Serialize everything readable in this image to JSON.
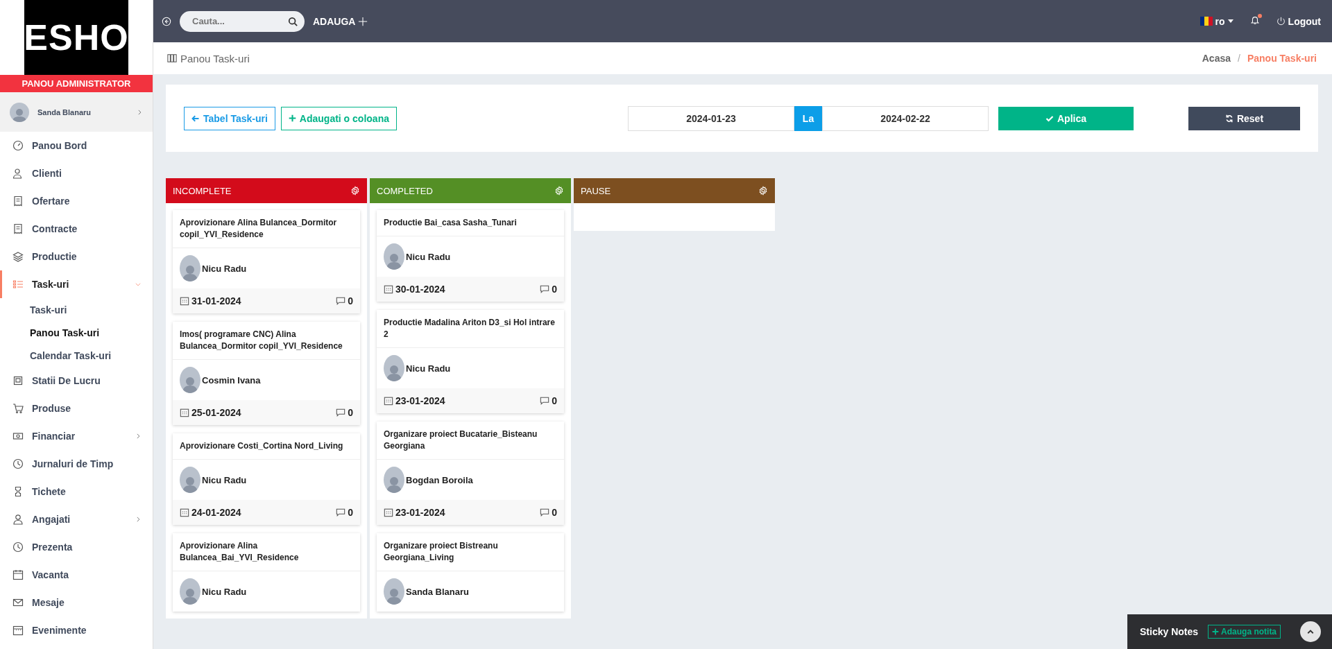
{
  "sidebar": {
    "logo": "ESHO",
    "role_banner": "PANOU ADMINISTRATOR",
    "user": {
      "name": "Sanda Blanaru"
    },
    "items": [
      {
        "label": "Panou Bord",
        "selected": false
      },
      {
        "label": "Clienti",
        "selected": false
      },
      {
        "label": "Ofertare",
        "selected": false
      },
      {
        "label": "Contracte",
        "selected": false
      },
      {
        "label": "Productie",
        "selected": false
      },
      {
        "label": "Task-uri",
        "selected": true,
        "expanded": true,
        "children": [
          {
            "label": "Task-uri",
            "selected": false
          },
          {
            "label": "Panou Task-uri",
            "selected": true
          },
          {
            "label": "Calendar Task-uri",
            "selected": false
          }
        ]
      },
      {
        "label": "Statii De Lucru",
        "selected": false
      },
      {
        "label": "Produse",
        "selected": false
      },
      {
        "label": "Financiar",
        "selected": false,
        "expanded": false
      },
      {
        "label": "Jurnaluri de Timp",
        "selected": false
      },
      {
        "label": "Tichete",
        "selected": false
      },
      {
        "label": "Angajati",
        "selected": false,
        "expanded": false
      },
      {
        "label": "Prezenta",
        "selected": false
      },
      {
        "label": "Vacanta",
        "selected": false
      },
      {
        "label": "Mesaje",
        "selected": false
      },
      {
        "label": "Evenimente",
        "selected": false
      }
    ]
  },
  "topbar": {
    "search": {
      "placeholder": "Cauta..."
    },
    "add_label": "ADAUGA",
    "language": "ro",
    "notification_dot": true,
    "logout": "Logout"
  },
  "page_header": {
    "title": "Panou Task-uri",
    "separator": "/",
    "breadcrumb": [
      {
        "label": "Acasa",
        "selected": false
      },
      {
        "label": "Panou Task-uri",
        "selected": true
      }
    ]
  },
  "filters": {
    "table_button": "Tabel Task-uri",
    "add_column_button": "Adaugati o coloana",
    "date_from": "2024-01-23",
    "separator": "La",
    "date_to": "2024-02-22",
    "apply": "Aplica",
    "reset": "Reset"
  },
  "columns": [
    {
      "title": "INCOMPLETE",
      "color": "#d30b1b",
      "cards": [
        {
          "title": "Aprovizionare Alina Bulancea_Dormitor copil_YVI_Residence",
          "assignee": "Nicu Radu",
          "date": "31-01-2024",
          "comments": "0"
        },
        {
          "title": "Imos( programare CNC) Alina Bulancea_Dormitor copil_YVI_Residence",
          "assignee": "Cosmin Ivana",
          "date": "25-01-2024",
          "comments": "0"
        },
        {
          "title": "Aprovizionare Costi_Cortina Nord_Living",
          "assignee": "Nicu Radu",
          "date": "24-01-2024",
          "comments": "0"
        },
        {
          "title": "Aprovizionare Alina Bulancea_Bai_YVI_Residence",
          "assignee": "Nicu Radu"
        }
      ]
    },
    {
      "title": "COMPLETED",
      "color": "#548f25",
      "cards": [
        {
          "title": "Productie Bai_casa Sasha_Tunari",
          "assignee": "Nicu Radu",
          "date": "30-01-2024",
          "comments": "0"
        },
        {
          "title": "Productie Madalina Ariton D3_si Hol intrare 2",
          "assignee": "Nicu Radu",
          "date": "23-01-2024",
          "comments": "0"
        },
        {
          "title": "Organizare proiect Bucatarie_Bisteanu Georgiana",
          "assignee": "Bogdan Boroila",
          "date": "23-01-2024",
          "comments": "0"
        },
        {
          "title": "Organizare proiect Bistreanu Georgiana_Living",
          "assignee": "Sanda Blanaru"
        }
      ]
    },
    {
      "title": "PAUSE",
      "color": "#7d4f20"
    }
  ],
  "sticky_notes": {
    "title": "Sticky Notes",
    "add_button": "Adauga notita"
  }
}
